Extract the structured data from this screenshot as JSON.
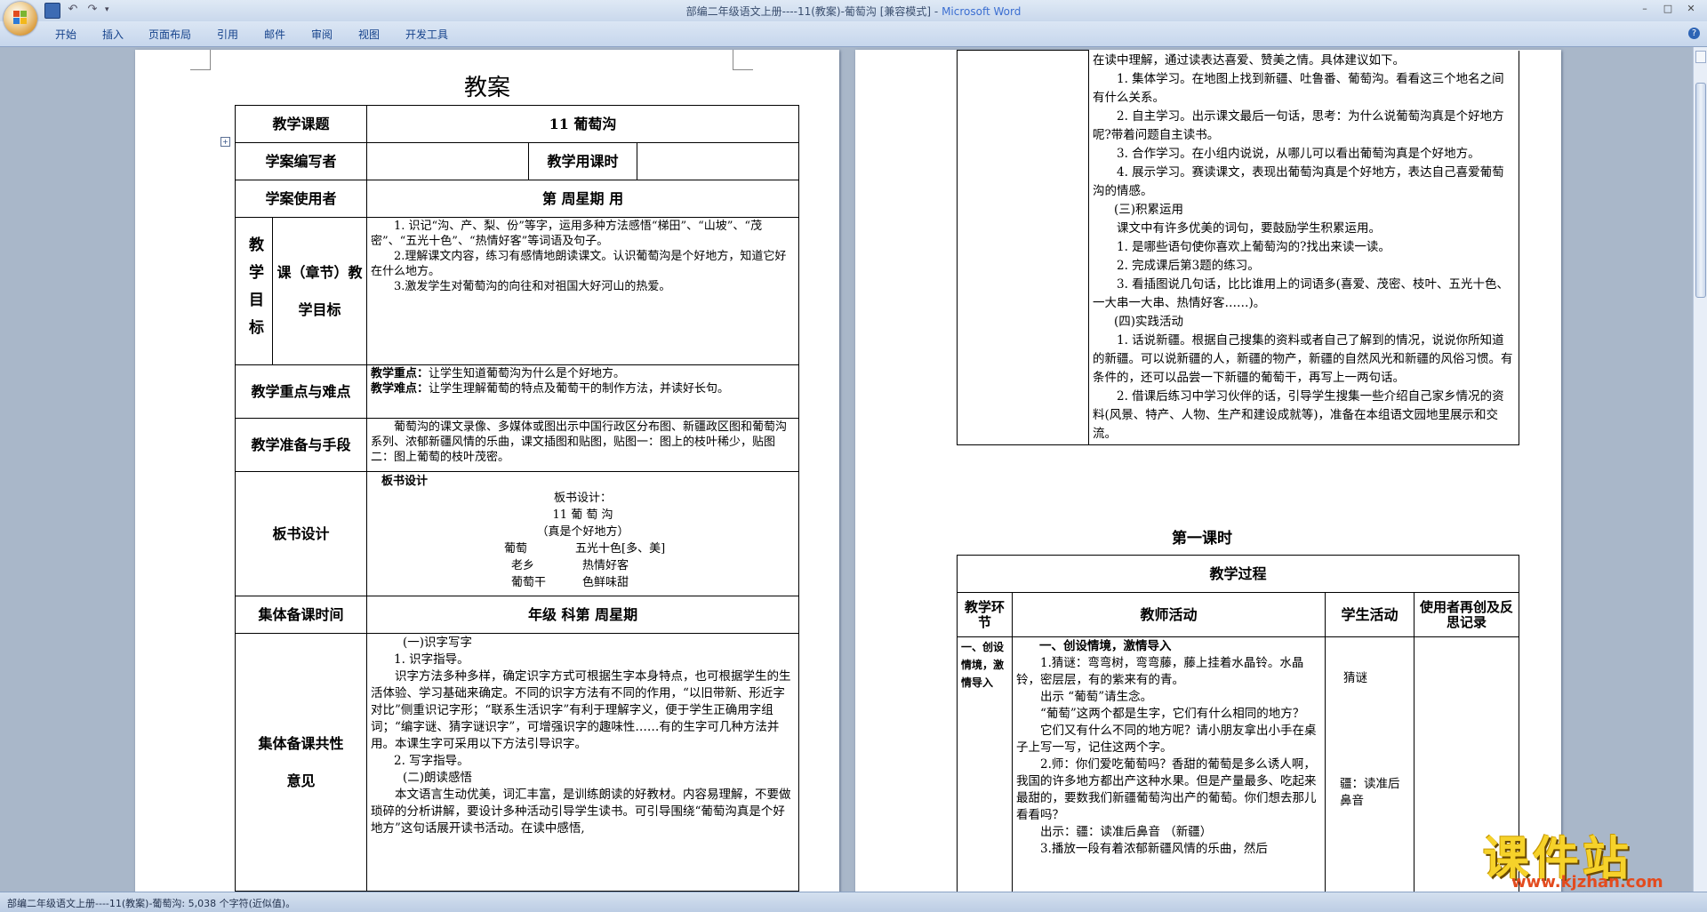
{
  "window": {
    "title": "部编二年级语文上册----11(教案)-葡萄沟 [兼容模式] - ",
    "app_name": "Microsoft Word"
  },
  "ribbon_tabs": [
    "开始",
    "插入",
    "页面布局",
    "引用",
    "邮件",
    "审阅",
    "视图",
    "开发工具"
  ],
  "status": "部编二年级语文上册----11(教案)-葡萄沟: 5,038 个字符(近似值)。",
  "page1": {
    "title": "教案",
    "subject_label": "教学课题",
    "subject_value": "11   葡萄沟",
    "author_label": "学案编写者",
    "hours_label": "教学用课时",
    "user_label": "学案使用者",
    "user_value": "第     周星期    用",
    "goals_label_a": "教学目标",
    "goals_label_b": "课（章节）教学目标",
    "goals": [
      "1. 识记“沟、产、梨、份”等字，运用多种方法感悟“梯田”、“山坡”、“茂密”、“五光十色”、“热情好客”等词语及句子。",
      "2.理解课文内容，练习有感情地朗读课文。认识葡萄沟是个好地方，知道它好在什么地方。",
      "3.激发学生对葡萄沟的向往和对祖国大好河山的热爱。"
    ],
    "key_label": "教学重点与难点",
    "key_point_label": "教学重点：",
    "key_point": "让学生知道葡萄沟为什么是个好地方。",
    "difficulty_label": "教学难点：",
    "difficulty": "让学生理解葡萄的特点及葡萄干的制作方法，并读好长句。",
    "prep_label": "教学准备与手段",
    "prep": "葡萄沟的课文录像、多媒体或图出示中国行政区分布图、新疆政区图和葡萄沟系列、浓郁新疆风情的乐曲，课文插图和贴图，贴图一：图上的枝叶稀少，贴图二：图上葡萄的枝叶茂密。",
    "board_label": "板书设计",
    "board": {
      "head": "板书设计",
      "sub": "板书设计：",
      "title": "11  葡 萄 沟",
      "subtitle": "（真是个好地方）",
      "rows": [
        [
          "葡萄",
          "五光十色[多、美]"
        ],
        [
          "老乡",
          "热情好客"
        ],
        [
          "葡萄干",
          "色鲜味甜"
        ]
      ]
    },
    "collective_time_label": "集体备课时间",
    "collective_time_value": "年级       科第     周星期",
    "collective_opinion_label": "集体备课共性意见",
    "opinion": [
      "(一)识字写字",
      "1. 识字指导。",
      "识字方法多种多样，确定识字方式可根据生字本身特点，也可根据学生的生活体验、学习基础来确定。不同的识字方法有不同的作用，“以旧带新、形近字对比”侧重识记字形；“联系生活识字”有利于理解字义，便于学生正确用字组词；“编字谜、猜字谜识字”，可增强识字的趣味性……有的生字可几种方法并用。本课生字可采用以下方法引导识字。",
      "2. 写字指导。",
      "(二)朗读感悟",
      "本文语言生动优美，词汇丰富，是训练朗读的好教材。内容易理解，不要做琐碎的分析讲解，要设计多种活动引导学生读书。可引导围绕“葡萄沟真是个好地方”这句话展开读书活动。在读中感悟,"
    ]
  },
  "page2": {
    "continued": [
      "在读中理解，通过读表达喜爱、赞美之情。具体建议如下。",
      "1. 集体学习。在地图上找到新疆、吐鲁番、葡萄沟。看看这三个地名之间有什么关系。",
      "2. 自主学习。出示课文最后一句话，思考：为什么说葡萄沟真是个好地方呢?带着问题自主读书。",
      "3. 合作学习。在小组内说说，从哪儿可以看出葡萄沟真是个好地方。",
      "4. 展示学习。赛读课文，表现出葡萄沟真是个好地方，表达自己喜爱葡萄沟的情感。",
      "(三)积累运用",
      "课文中有许多优美的词句，要鼓励学生积累运用。",
      "1. 是哪些语句使你喜欢上葡萄沟的?找出来读一读。",
      "2. 完成课后第3题的练习。",
      "3. 看插图说几句话，比比谁用上的词语多(喜爱、茂密、枝叶、五光十色、一大串一大串、热情好客……)。",
      "(四)实践活动",
      "1. 话说新疆。根据自己搜集的资料或者自己了解到的情况，说说你所知道的新疆。可以说新疆的人，新疆的物产，新疆的自然风光和新疆的风俗习惯。有条件的，还可以品尝一下新疆的葡萄干，再写上一两句话。",
      "2. 借课后练习中学习伙伴的话，引导学生搜集一些介绍自己家乡情况的资料(风景、特产、人物、生产和建设成就等)，准备在本组语文园地里展示和交流。"
    ],
    "lesson_title": "第一课时",
    "process_title": "教学过程",
    "headers": [
      "教学环节",
      "教师活动",
      "学生活动",
      "使用者再创及反思记录"
    ],
    "stage": "一、创设情境，激情导入",
    "teacher": [
      "一、创设情境，激情导入",
      "1.猜谜：弯弯树，弯弯藤，藤上挂着水晶铃。水晶铃，密层层，有的紫来有的青。",
      "出示 “葡萄”请生念。",
      "“葡萄”这两个都是生字，它们有什么相同的地方？",
      "它们又有什么不同的地方呢？请小朋友拿出小手在桌子上写一写，记住这两个字。",
      "2.师：你们爱吃葡萄吗？香甜的葡萄是多么诱人啊，我国的许多地方都出产这种水果。但是产量最多、吃起来最甜的，要数我们新疆葡萄沟出产的葡萄。你们想去那儿看看吗？",
      "出示：疆：读准后鼻音  （新疆）",
      "3.播放一段有着浓郁新疆风情的乐曲，然后"
    ],
    "student_a": "猜谜",
    "student_b": "疆：读准后鼻音"
  },
  "watermark": {
    "text": "课件站",
    "url": "www.kjzhan.com"
  }
}
